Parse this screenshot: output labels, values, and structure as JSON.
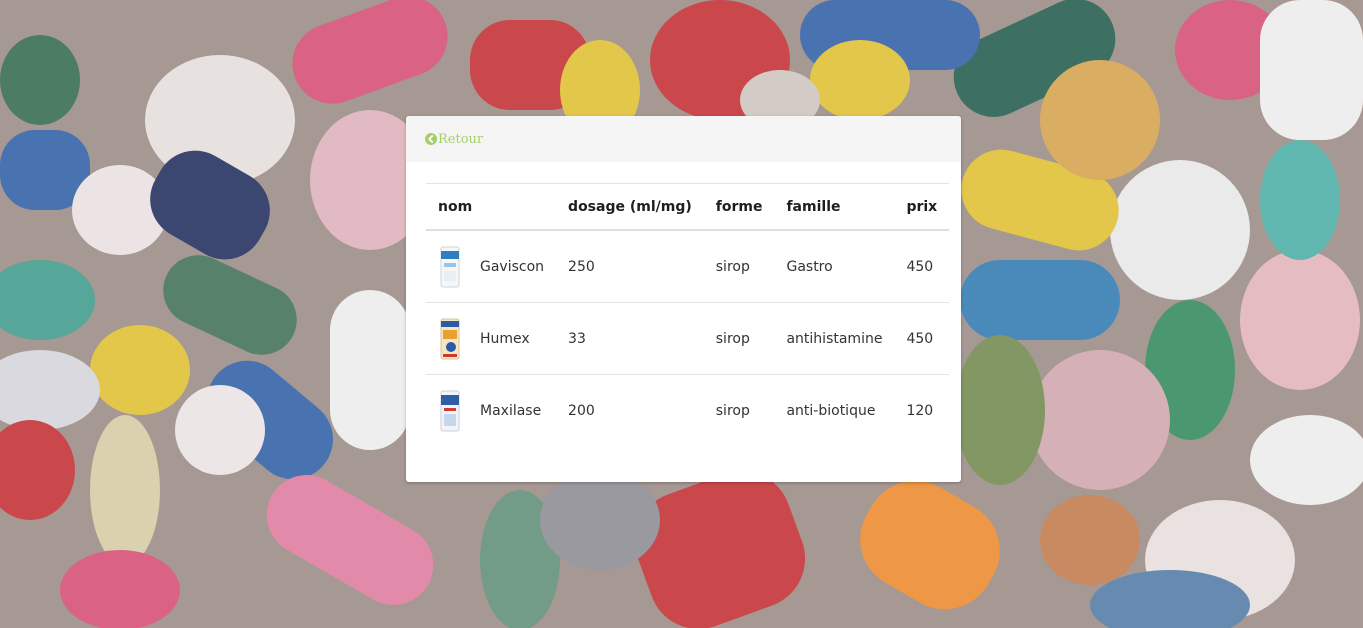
{
  "header": {
    "back_label": "Retour",
    "back_icon": "chevron-circle-left-icon"
  },
  "colors": {
    "accent": "#a6cf6a",
    "header_bg": "#f5f5f5",
    "card_bg": "#ffffff"
  },
  "table": {
    "columns": [
      "nom",
      "dosage (ml/mg)",
      "forme",
      "famille",
      "prix"
    ],
    "rows": [
      {
        "nom": "Gaviscon",
        "dosage": "250",
        "forme": "sirop",
        "famille": "Gastro",
        "prix": "450"
      },
      {
        "nom": "Humex",
        "dosage": "33",
        "forme": "sirop",
        "famille": "antihistamine",
        "prix": "450"
      },
      {
        "nom": "Maxilase",
        "dosage": "200",
        "forme": "sirop",
        "famille": "anti-biotique",
        "prix": "120"
      }
    ]
  }
}
